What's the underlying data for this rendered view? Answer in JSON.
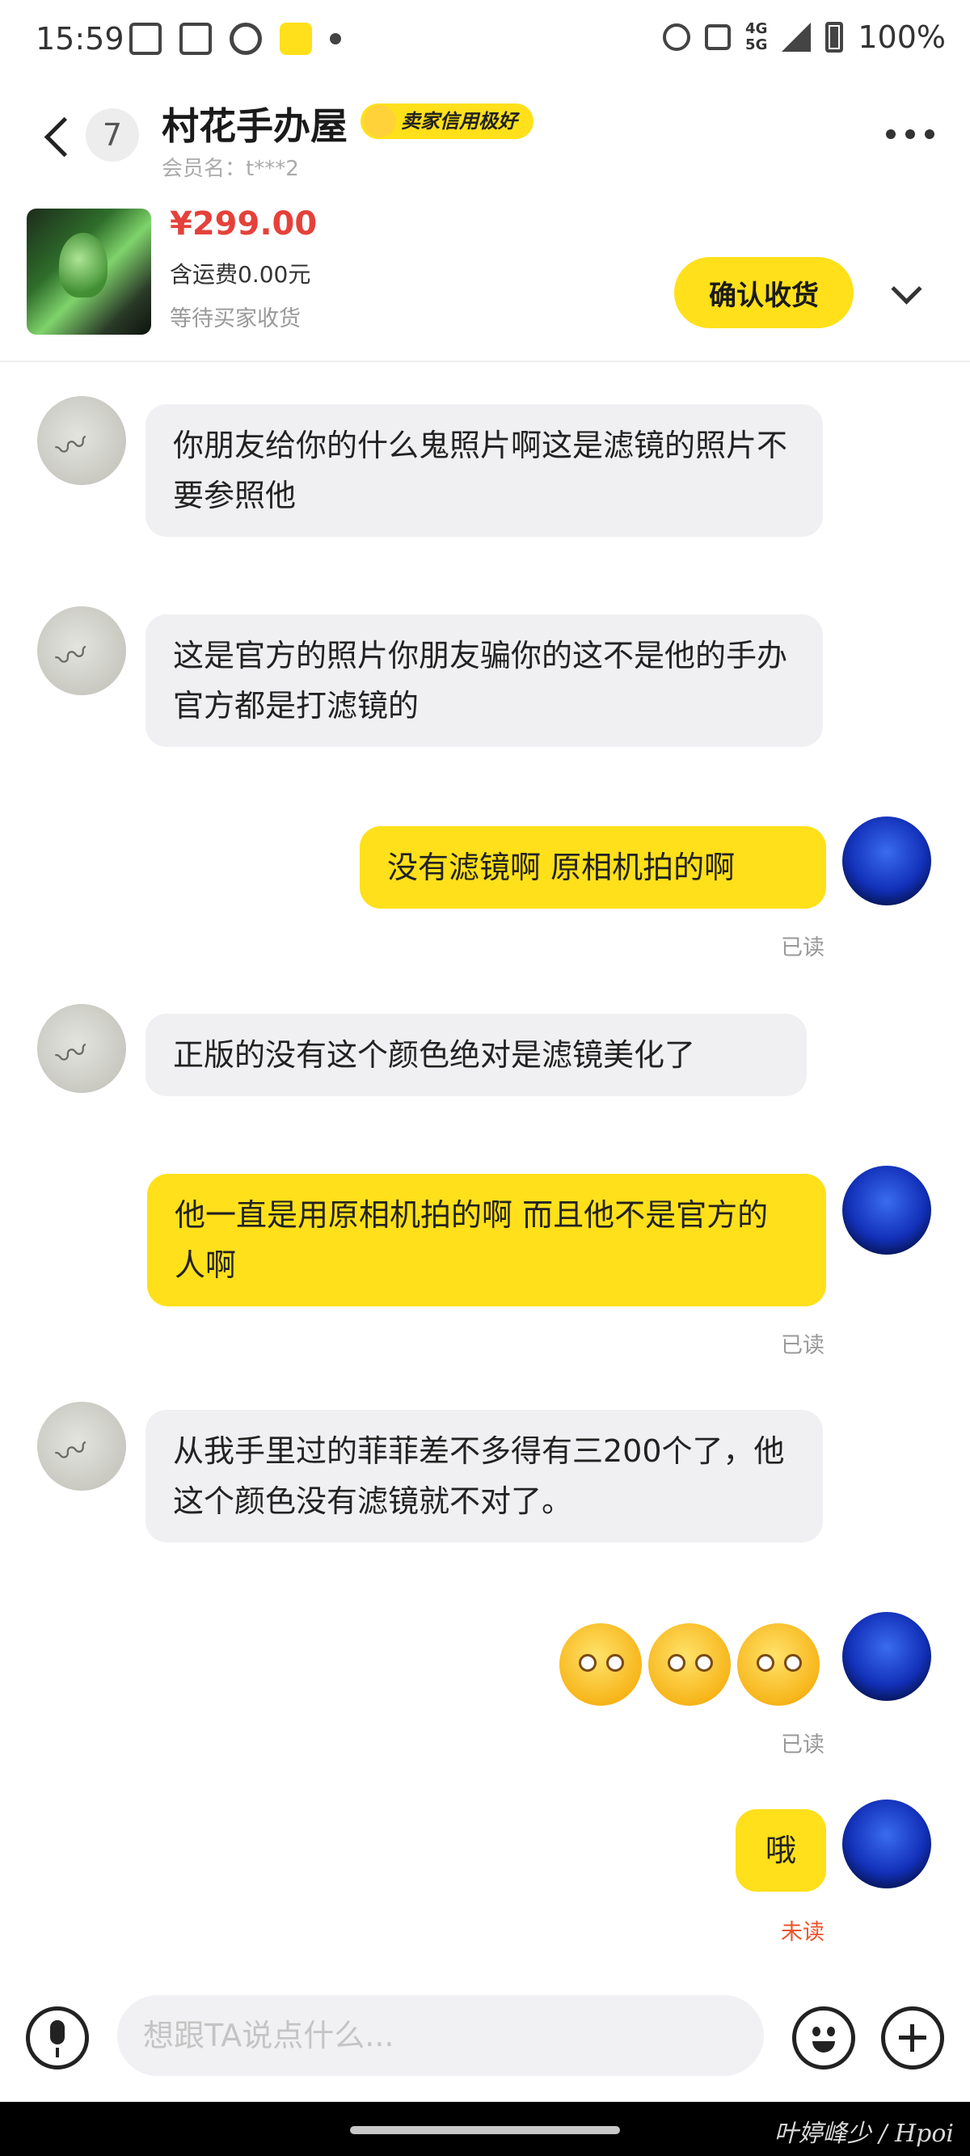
{
  "status_bar": {
    "time": "15:59",
    "network": "4G\n5G",
    "battery": "100%",
    "icons": [
      "message-icon",
      "copy-icon",
      "wechat-icon",
      "xianyu-icon",
      "dot-icon",
      "alarm-icon",
      "nfc-icon",
      "signal-icon",
      "battery-icon"
    ]
  },
  "header": {
    "unread_count": "7",
    "shop_name": "村花手办屋",
    "credit_badge": "卖家信用极好",
    "member": "会员名：t***2"
  },
  "product": {
    "price": "¥299.00",
    "shipping": "含运费0.00元",
    "status": "等待买家收货",
    "confirm_button": "确认收货"
  },
  "messages": [
    {
      "side": "in",
      "text": "你朋友给你的什么鬼照片啊这是滤镜的照片不要参照他"
    },
    {
      "side": "in",
      "text": "这是官方的照片你朋友骗你的这不是他的手办官方都是打滤镜的"
    },
    {
      "side": "out",
      "text": "没有滤镜啊  原相机拍的啊",
      "status": "已读"
    },
    {
      "side": "in",
      "text": "正版的没有这个颜色绝对是滤镜美化了"
    },
    {
      "side": "out",
      "text": "他一直是用原相机拍的啊  而且他不是官方的人啊",
      "status": "已读"
    },
    {
      "side": "in",
      "text": "从我手里过的菲菲差不多得有三200个了，他这个颜色没有滤镜就不对了。"
    },
    {
      "side": "out",
      "emoji": [
        "flushed-face-emoji",
        "flushed-face-emoji",
        "flushed-face-emoji"
      ],
      "status": "已读"
    },
    {
      "side": "out",
      "text": "哦",
      "status": "未读"
    }
  ],
  "input": {
    "placeholder": "想跟TA说点什么..."
  },
  "watermark": "叶婷峰少 / Hpoi",
  "colors": {
    "accent_yellow": "#ffe01a",
    "price_red": "#e5413a",
    "unread_orange": "#e8542c",
    "incoming_bubble": "#f0f0f2"
  }
}
